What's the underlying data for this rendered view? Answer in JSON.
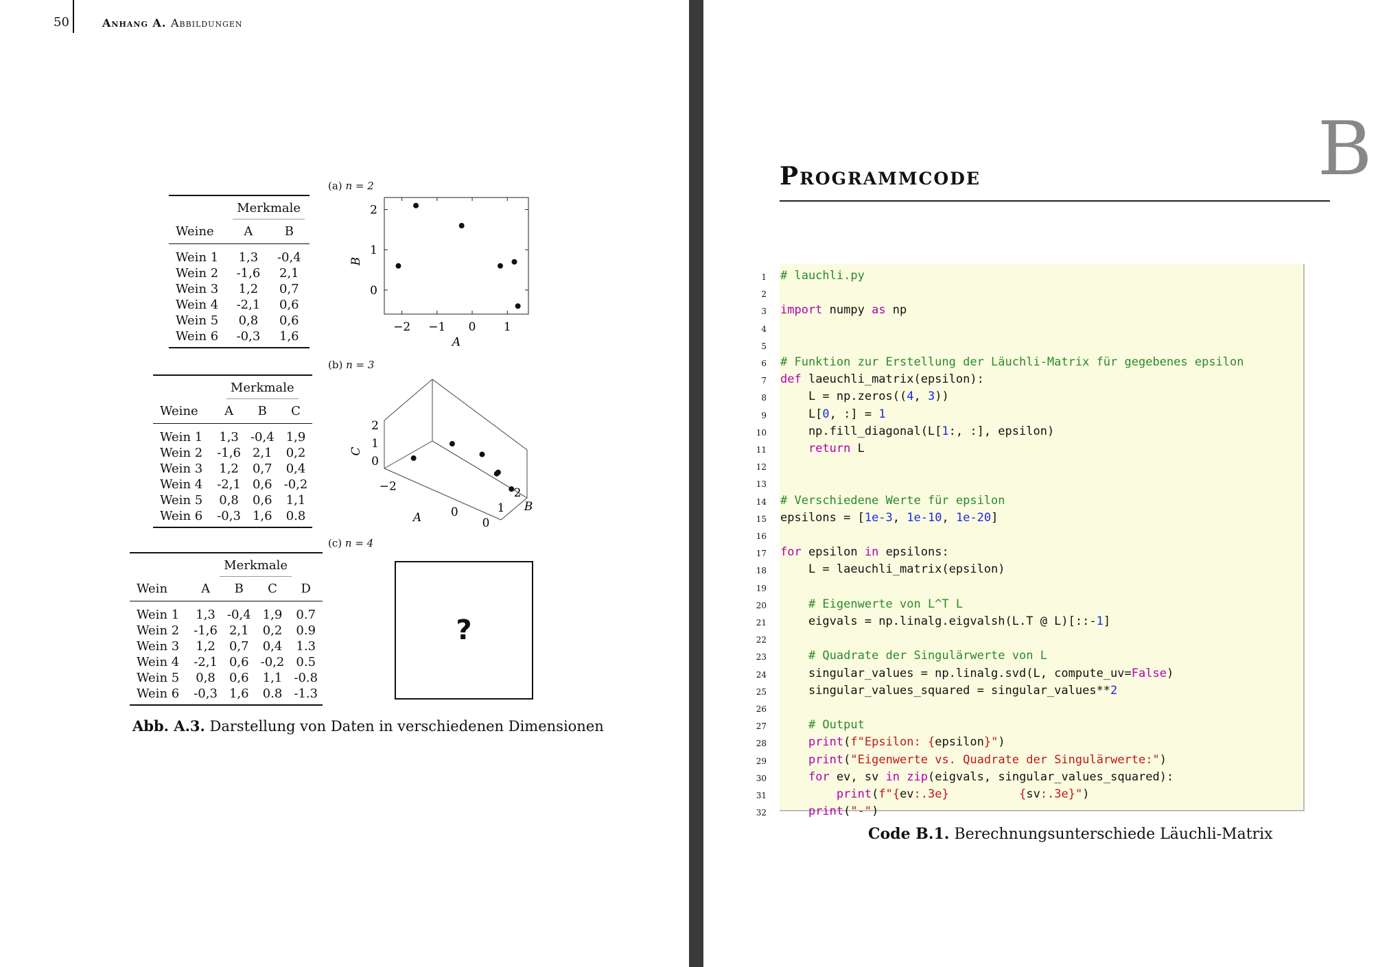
{
  "header": {
    "page_number": "50",
    "appendix": "Anhang A.",
    "section": "Abbildungen"
  },
  "figure": {
    "caption_label": "Abb. A.3.",
    "caption_text": "Darstellung von Daten in verschiedenen Dimensionen",
    "subfigs": [
      {
        "label": "(a)",
        "cond": "n = 2"
      },
      {
        "label": "(b)",
        "cond": "n = 3"
      },
      {
        "label": "(c)",
        "cond": "n = 4"
      }
    ],
    "question_mark": "?"
  },
  "tables": [
    {
      "group_header": "Merkmale",
      "row_header": "Weine",
      "columns": [
        "A",
        "B"
      ],
      "rows": [
        [
          "Wein 1",
          "1,3",
          "-0,4"
        ],
        [
          "Wein 2",
          "-1,6",
          "2,1"
        ],
        [
          "Wein 3",
          "1,2",
          "0,7"
        ],
        [
          "Wein 4",
          "-2,1",
          "0,6"
        ],
        [
          "Wein 5",
          "0,8",
          "0,6"
        ],
        [
          "Wein 6",
          "-0,3",
          "1,6"
        ]
      ]
    },
    {
      "group_header": "Merkmale",
      "row_header": "Weine",
      "columns": [
        "A",
        "B",
        "C"
      ],
      "rows": [
        [
          "Wein 1",
          "1,3",
          "-0,4",
          "1,9"
        ],
        [
          "Wein 2",
          "-1,6",
          "2,1",
          "0,2"
        ],
        [
          "Wein 3",
          "1,2",
          "0,7",
          "0,4"
        ],
        [
          "Wein 4",
          "-2,1",
          "0,6",
          "-0,2"
        ],
        [
          "Wein 5",
          "0,8",
          "0,6",
          "1,1"
        ],
        [
          "Wein 6",
          "-0,3",
          "1,6",
          "0.8"
        ]
      ]
    },
    {
      "group_header": "Merkmale",
      "row_header": "Wein",
      "columns": [
        "A",
        "B",
        "C",
        "D"
      ],
      "rows": [
        [
          "Wein 1",
          "1,3",
          "-0,4",
          "1,9",
          "0.7"
        ],
        [
          "Wein 2",
          "-1,6",
          "2,1",
          "0,2",
          "0.9"
        ],
        [
          "Wein 3",
          "1,2",
          "0,7",
          "0,4",
          "1.3"
        ],
        [
          "Wein 4",
          "-2,1",
          "0,6",
          "-0,2",
          "0.5"
        ],
        [
          "Wein 5",
          "0,8",
          "0,6",
          "1,1",
          "-0.8"
        ],
        [
          "Wein 6",
          "-0,3",
          "1,6",
          "0.8",
          "-1.3"
        ]
      ]
    }
  ],
  "chart_data": [
    {
      "type": "scatter",
      "xlabel": "A",
      "ylabel": "B",
      "x": [
        1.3,
        -1.6,
        1.2,
        -2.1,
        0.8,
        -0.3
      ],
      "y": [
        -0.4,
        2.1,
        0.7,
        0.6,
        0.6,
        1.6
      ],
      "xlim": [
        -2.5,
        1.6
      ],
      "ylim": [
        -0.6,
        2.3
      ],
      "xticks": [
        "−2",
        "−1",
        "0",
        "1"
      ],
      "yticks": [
        "0",
        "1",
        "2"
      ],
      "grid": false
    },
    {
      "type": "scatter",
      "xlabel": "A",
      "ylabel": "C",
      "zlabel": "B",
      "x": [
        1.3,
        -1.6,
        1.2,
        -2.1,
        0.8,
        -0.3
      ],
      "y": [
        -0.4,
        2.1,
        0.7,
        0.6,
        0.6,
        1.6
      ],
      "z": [
        1.9,
        0.2,
        0.4,
        -0.2,
        1.1,
        0.8
      ],
      "xticks": [
        "−2",
        "0"
      ],
      "yticks": [
        "0",
        "1",
        "2"
      ],
      "zticks": [
        "0",
        "1",
        "2"
      ]
    }
  ],
  "chapter": {
    "title": "Programmcode",
    "letter": "B"
  },
  "code": {
    "caption_label": "Code B.1.",
    "caption_text": "Berechnungsunterschiede Läuchli-Matrix",
    "lines": [
      "# lauchli.py",
      "",
      "import numpy as np",
      "",
      "",
      "# Funktion zur Erstellung der Läuchli-Matrix für gegebenes epsilon",
      "def laeuchli_matrix(epsilon):",
      "    L = np.zeros((4, 3))",
      "    L[0, :] = 1",
      "    np.fill_diagonal(L[1:, :], epsilon)",
      "    return L",
      "",
      "",
      "# Verschiedene Werte für epsilon",
      "epsilons = [1e-3, 1e-10, 1e-20]",
      "",
      "for epsilon in epsilons:",
      "    L = laeuchli_matrix(epsilon)",
      "",
      "    # Eigenwerte von L^T L",
      "    eigvals = np.linalg.eigvalsh(L.T @ L)[::-1]",
      "",
      "    # Quadrate der Singulärwerte von L",
      "    singular_values = np.linalg.svd(L, compute_uv=False)",
      "    singular_values_squared = singular_values**2",
      "",
      "    # Output",
      "    print(f\"Epsilon: {epsilon}\")",
      "    print(\"Eigenwerte vs. Quadrate der Singulärwerte:\")",
      "    for ev, sv in zip(eigvals, singular_values_squared):",
      "        print(f\"{ev:.3e}          {sv:.3e}\")",
      "    print(\"-\")"
    ]
  }
}
